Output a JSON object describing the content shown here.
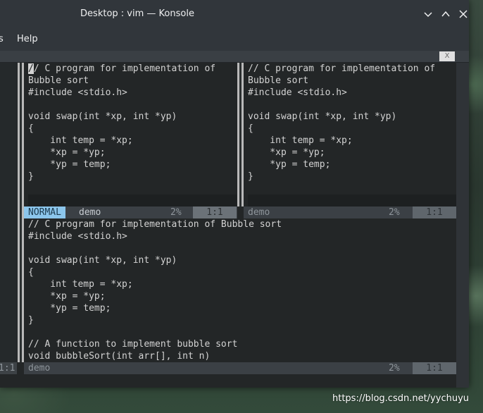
{
  "window": {
    "title": "Desktop : vim — Konsole",
    "controls": {
      "minimize": "⌄",
      "maximize": "⌃",
      "close": "✕"
    }
  },
  "menubar": {
    "items": [
      "s",
      "Help"
    ]
  },
  "tab": {
    "close_label": "X"
  },
  "panes": {
    "top_left": {
      "lines": [
        "// C program for implementation of",
        "Bubble sort",
        "#include <stdio.h>",
        "",
        "void swap(int *xp, int *yp)",
        "{",
        "    int temp = *xp;",
        "    *xp = *yp;",
        "    *yp = temp;",
        "}",
        "",
        "@"
      ],
      "status": {
        "mode": "NORMAL",
        "file": "demo",
        "percent": "2%",
        "position": "1:1"
      }
    },
    "top_right": {
      "lines": [
        "// C program for implementation of",
        "Bubble sort",
        "#include <stdio.h>",
        "",
        "void swap(int *xp, int *yp)",
        "{",
        "    int temp = *xp;",
        "    *xp = *yp;",
        "    *yp = temp;",
        "}",
        "",
        "@"
      ],
      "status": {
        "file": "demo",
        "percent": "2%",
        "position": "1:1"
      }
    },
    "bottom": {
      "lines": [
        "// C program for implementation of Bubble sort",
        "#include <stdio.h>",
        "",
        "void swap(int *xp, int *yp)",
        "{",
        "    int temp = *xp;",
        "    *xp = *yp;",
        "    *yp = temp;",
        "}",
        "",
        "// A function to implement bubble sort",
        "void bubbleSort(int arr[], int n)"
      ],
      "status": {
        "file": "demo",
        "percent": "2%",
        "position": "1:1"
      }
    },
    "left_partial_status": "1:1"
  },
  "watermark": "https://blog.csdn.net/yychuyu"
}
